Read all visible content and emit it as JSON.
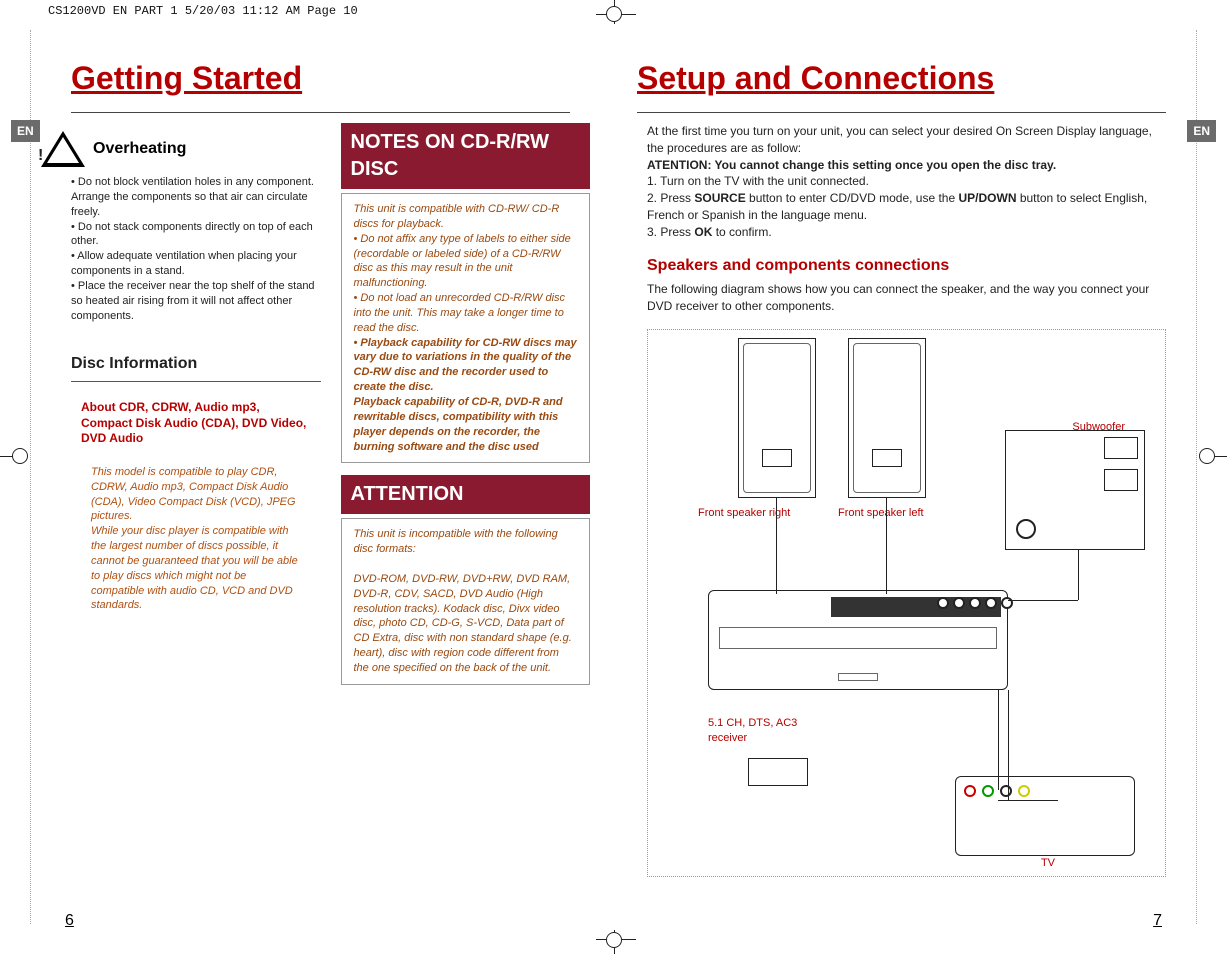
{
  "print_header": "CS1200VD EN PART 1  5/20/03  11:12 AM  Page 10",
  "lang_tab": "EN",
  "left": {
    "title": "Getting Started",
    "overheating_h": "Overheating",
    "overheating_body": "• Do not block ventilation holes in any component. Arrange the components so that air can circulate freely.\n• Do not stack components directly on top of each other.\n•  Allow adequate ventilation when placing your components in a stand.\n•  Place the receiver near the top shelf of the stand so heated air rising from it will not affect other components.",
    "disc_info_h": "Disc Information",
    "about_box": "About CDR, CDRW, Audio mp3, Compact Disk Audio (CDA), DVD Video, DVD Audio",
    "about_body": "This model is compatible to play CDR, CDRW, Audio mp3, Compact Disk Audio (CDA), Video Compact Disk (VCD), JPEG pictures.\nWhile your disc player is compatible with the largest number of discs possible, it cannot be guaranteed that you will be able to play discs which might not be compatible with audio CD, VCD and DVD standards.",
    "notes_head": "NOTES ON CD-R/RW DISC",
    "notes_body1": "This unit is compatible with CD-RW/ CD-R discs for playback.\n• Do not affix any type of labels to either side (recordable or labeled side) of a CD-R/RW disc as this may result in the unit malfunctioning.\n• Do not load an unrecorded CD-R/RW disc into the unit. This may take a longer time to read the disc.",
    "notes_body2": "• Playback capability for CD-RW discs may vary due to variations in the quality of the CD-RW disc and the recorder used to create the disc.\nPlayback capability of CD-R, DVD-R and rewritable discs, compatibility with this player depends on the recorder,  the burning software and the disc used",
    "attention_head": "ATTENTION",
    "attention_body": "This unit is incompatible with the following disc formats:\n\nDVD-ROM, DVD-RW, DVD+RW, DVD RAM, DVD-R, CDV, SACD, DVD Audio (High resolution tracks). Kodack disc, Divx video disc, photo CD, CD-G, S-VCD, Data part of CD Extra, disc with non standard shape (e.g. heart), disc with region code different from the one specified on the back of the unit."
  },
  "right": {
    "title": "Setup and Connections",
    "intro1": "At the first time you turn on your unit, you can select your desired On Screen Display language, the procedures are as follow:",
    "intro_bold": "ATENTION: You cannot change this setting once you open the disc tray.",
    "step1": "1.  Turn on the TV with the unit connected.",
    "step2a": "2.  Press ",
    "step2_source": "SOURCE",
    "step2b": " button to enter CD/DVD mode, use the ",
    "step2_updown": "UP/DOWN",
    "step2c": " button to select English, French or Spanish in the language menu.",
    "step3a": "3. Press ",
    "step3_ok": "OK",
    "step3b": " to confirm.",
    "spk_h": "Speakers and components connections",
    "spk_p": "The following diagram shows how you can connect the speaker, and the way you connect your DVD receiver to other components.",
    "labels": {
      "spk_r": "Front speaker right",
      "spk_l": "Front speaker left",
      "sub": "Subwoofer",
      "recv": "5.1 CH, DTS, AC3 receiver",
      "tv": "TV"
    }
  },
  "page_left_num": "6",
  "page_right_num": "7"
}
